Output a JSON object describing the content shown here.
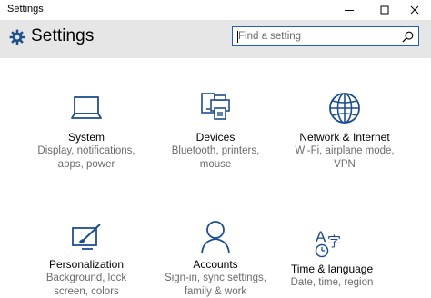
{
  "window": {
    "title": "Settings",
    "controls": [
      "minimize-icon",
      "maximize-icon",
      "close-icon"
    ]
  },
  "header": {
    "app_icon": "gear-icon",
    "title": "Settings",
    "search": {
      "placeholder": "Find a setting",
      "value": "",
      "icon": "search-icon"
    }
  },
  "colors": {
    "accent": "#1f4e8c",
    "header_bg": "#e6e6e6",
    "search_border": "#1f5fbf",
    "description": "#6b6b6b"
  },
  "tiles": [
    {
      "icon": "laptop-icon",
      "label": "System",
      "desc1": "Display, notifications,",
      "desc2": "apps, power"
    },
    {
      "icon": "devices-icon",
      "label": "Devices",
      "desc1": "Bluetooth, printers,",
      "desc2": "mouse"
    },
    {
      "icon": "globe-icon",
      "label": "Network & Internet",
      "desc1": "Wi-Fi, airplane mode,",
      "desc2": "VPN"
    },
    {
      "icon": "personalization-icon",
      "label": "Personalization",
      "desc1": "Background, lock",
      "desc2": "screen, colors"
    },
    {
      "icon": "person-icon",
      "label": "Accounts",
      "desc1": "Sign-in, sync settings,",
      "desc2": "family & work"
    },
    {
      "icon": "time-language-icon",
      "label": "Time & language",
      "desc1": "Date, time, region",
      "desc2": ""
    }
  ]
}
